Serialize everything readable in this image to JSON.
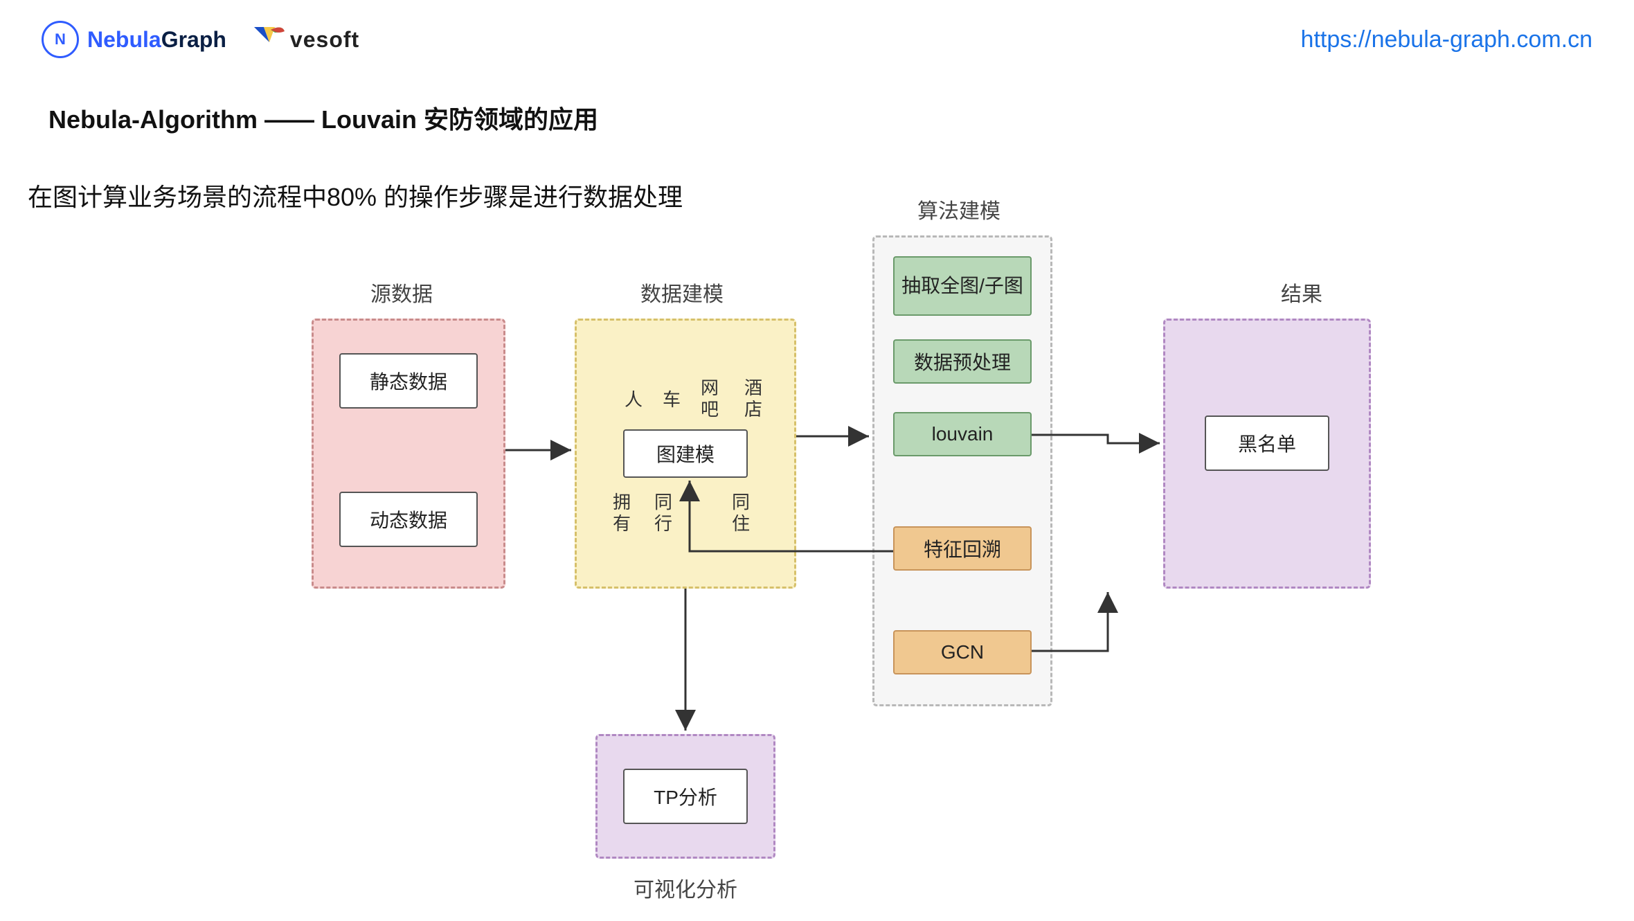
{
  "header": {
    "brand_blue": "Nebula",
    "brand_dark": "Graph",
    "vesoft": "vesoft",
    "url": "https://nebula-graph.com.cn"
  },
  "title": "Nebula-Algorithm   ——   Louvain 安防领域的应用",
  "subtitle": "在图计算业务场景的流程中80% 的操作步骤是进行数据处理",
  "groups": {
    "source": "源数据",
    "modeling": "数据建模",
    "algo": "算法建模",
    "result": "结果",
    "viz": "可视化分析"
  },
  "source": {
    "static": "静态数据",
    "dynamic": "动态数据"
  },
  "modeling": {
    "center": "图建模",
    "top": {
      "a": "人",
      "b": "车",
      "c": "网吧",
      "d": "酒店"
    },
    "bottom": {
      "a": "拥有",
      "b": "同行",
      "c": "同住"
    }
  },
  "algo": {
    "a": "抽取全图/子图",
    "b": "数据预处理",
    "c": "louvain",
    "d": "特征回溯",
    "e": "GCN"
  },
  "result": {
    "blacklist": "黑名单"
  },
  "viz": {
    "tp": "TP分析"
  }
}
